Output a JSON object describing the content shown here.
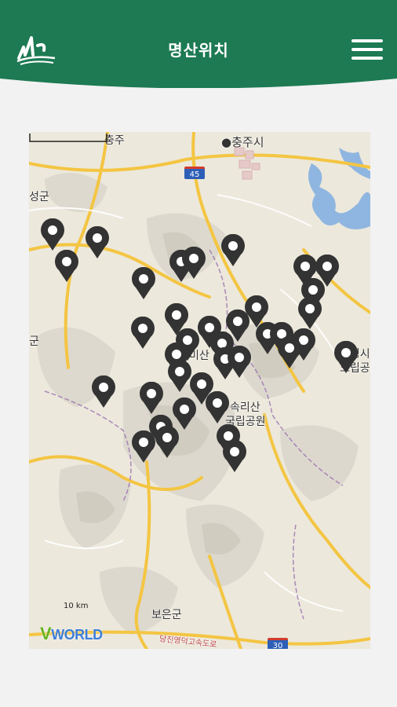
{
  "header": {
    "title": "명산위치",
    "brand_color": "#1d7a53"
  },
  "map": {
    "labels": {
      "chungju": "충주",
      "chungju_si": "충주시",
      "seonggun": "성군",
      "gun_left": "군",
      "munkyeong": "문경시",
      "dorip": "도립공",
      "songni_1": "속리산",
      "songni_2": "국립공원",
      "boeun": "보은군",
      "misan": "미산",
      "road_bottom": "당진영덕고속도로"
    },
    "highway_45": "45",
    "highway_30": "30",
    "scale_text": "10 km",
    "provider": {
      "v": "V",
      "rest": "WORLD"
    },
    "marker_color": "#333333",
    "marker_count": 37
  }
}
